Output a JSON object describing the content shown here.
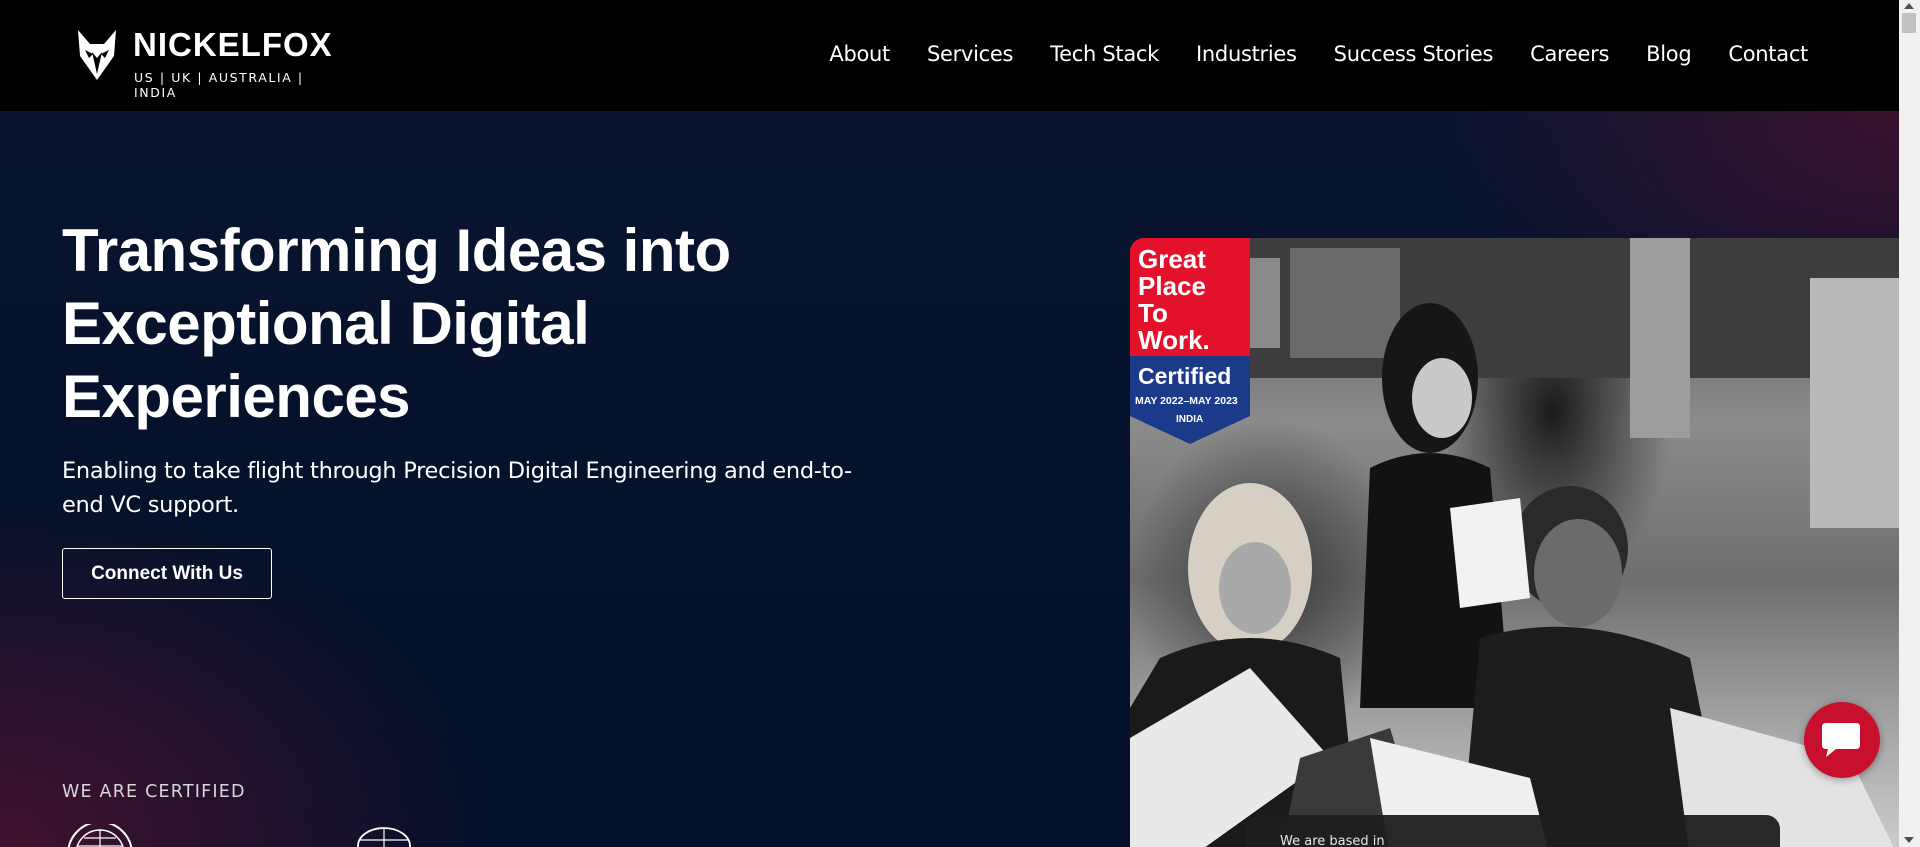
{
  "brand": {
    "name": "NICKELFOX",
    "tagline": "US | UK | AUSTRALIA | INDIA",
    "logo_icon": "fox-head-icon"
  },
  "nav": {
    "items": [
      "About",
      "Services",
      "Tech Stack",
      "Industries",
      "Success Stories",
      "Careers",
      "Blog",
      "Contact"
    ]
  },
  "hero": {
    "title": "Transforming Ideas into Exceptional Digital Experiences",
    "subtitle": "Enabling to take flight through Precision Digital Engineering and end-to-end VC support.",
    "cta_label": "Connect With Us",
    "certified_label": "WE ARE CERTIFIED"
  },
  "badge": {
    "line1": "Great",
    "line2": "Place",
    "line3": "To",
    "line4": "Work.",
    "certified": "Certified",
    "period": "MAY 2022–MAY 2023",
    "country": "INDIA"
  },
  "based_overlay": {
    "text": "We are based in"
  },
  "chat": {
    "icon": "chat-bubble-icon"
  },
  "colors": {
    "header_bg": "#000000",
    "hero_bg": "#05122b",
    "accent_red": "#c8102e",
    "badge_blue": "#1b3a8a"
  }
}
